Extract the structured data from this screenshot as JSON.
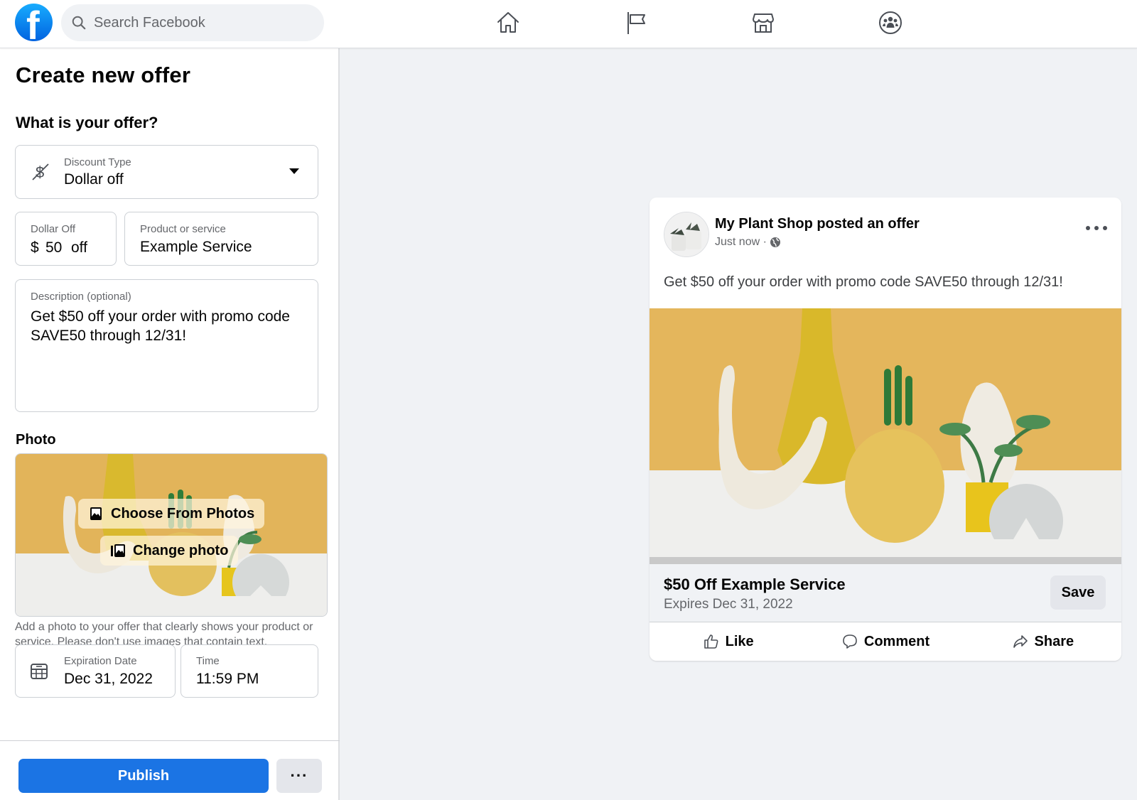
{
  "topbar": {
    "logo_letter": "f",
    "search_placeholder": "Search Facebook",
    "nav_icons": [
      "home-icon",
      "pages-flag-icon",
      "marketplace-icon",
      "groups-icon"
    ]
  },
  "form": {
    "title": "Create new offer",
    "section_title": "What is your offer?",
    "discount_type": {
      "label": "Discount Type",
      "value": "Dollar off",
      "icon": "no-dollar-icon"
    },
    "dollar_off": {
      "label": "Dollar Off",
      "prefix": "$",
      "value": "50",
      "suffix": "off"
    },
    "product": {
      "label": "Product or service",
      "value": "Example Service"
    },
    "description": {
      "label": "Description (optional)",
      "value": "Get $50 off your order with promo code SAVE50 through 12/31!"
    },
    "photo": {
      "label": "Photo",
      "choose_button": "Choose From Photos",
      "change_button": "Change photo",
      "helper": "Add a photo to your offer that clearly shows your product or service. Please don't use images that contain text."
    },
    "expiration": {
      "label": "Expiration Date",
      "value": "Dec 31, 2022",
      "icon": "calendar-icon"
    },
    "time": {
      "label": "Time",
      "value": "11:59 PM"
    },
    "publish_label": "Publish",
    "more_label": "···"
  },
  "preview": {
    "author": "My Plant Shop posted an offer",
    "timestamp": "Just now ·",
    "post_text": "Get $50 off your order with promo code SAVE50 through 12/31!",
    "offer_title": "$50 Off Example Service",
    "offer_expires": "Expires Dec 31, 2022",
    "save_label": "Save",
    "actions": {
      "like": "Like",
      "comment": "Comment",
      "share": "Share"
    }
  },
  "colors": {
    "brand_blue": "#1b74e4",
    "background": "#f0f2f5",
    "secondary_text": "#65676b"
  }
}
